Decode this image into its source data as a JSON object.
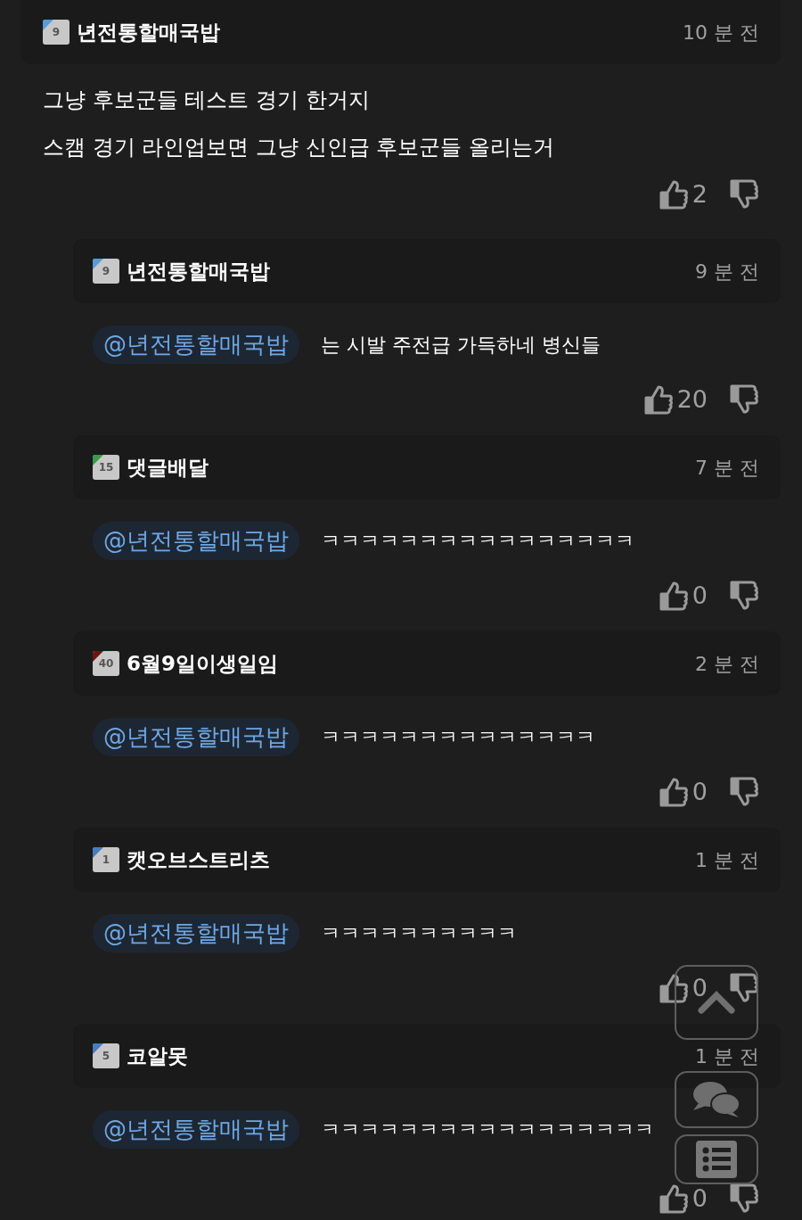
{
  "comments": [
    {
      "kind": "comment",
      "level": "9",
      "color": "#5a9bd5",
      "author": "년전통할매국밥",
      "time": "10 분 전",
      "text": "그냥 후보군들 테스트 경기 한거지\n스캠 경기 라인업보면 그냥 신인급 후보군들 올리는거",
      "likes": "2"
    },
    {
      "kind": "reply",
      "level": "9",
      "color": "#5a9bd5",
      "author": "년전통할매국밥",
      "time": "9 분 전",
      "mention": "@년전통할매국밥",
      "text": "는 시발 주전급 가득하네 병신들",
      "likes": "20"
    },
    {
      "kind": "reply",
      "level": "15",
      "color": "#3c9a4a",
      "author": "댓글배달",
      "time": "7 분 전",
      "mention": "@년전통할매국밥",
      "text": "ㅋㅋㅋㅋㅋㅋㅋㅋㅋㅋㅋㅋㅋㅋㅋㅋ",
      "likes": "0"
    },
    {
      "kind": "reply",
      "level": "40",
      "color": "#6b1414",
      "author": "6월9일이생일임",
      "time": "2 분 전",
      "mention": "@년전통할매국밥",
      "text": "ㅋㅋㅋㅋㅋㅋㅋㅋㅋㅋㅋㅋㅋㅋ",
      "likes": "0"
    },
    {
      "kind": "reply",
      "level": "1",
      "color": "#4a7bbd",
      "author": "캣오브스트리츠",
      "time": "1 분 전",
      "mention": "@년전통할매국밥",
      "text": "ㅋㅋㅋㅋㅋㅋㅋㅋㅋㅋ",
      "likes": "0"
    },
    {
      "kind": "reply",
      "level": "5",
      "color": "#4a7bbd",
      "author": "코알못",
      "time": "1 분 전",
      "mention": "@년전통할매국밥",
      "text": "ㅋㅋㅋㅋㅋㅋㅋㅋㅋㅋㅋㅋㅋㅋㅋㅋㅋ",
      "likes": "0"
    }
  ]
}
